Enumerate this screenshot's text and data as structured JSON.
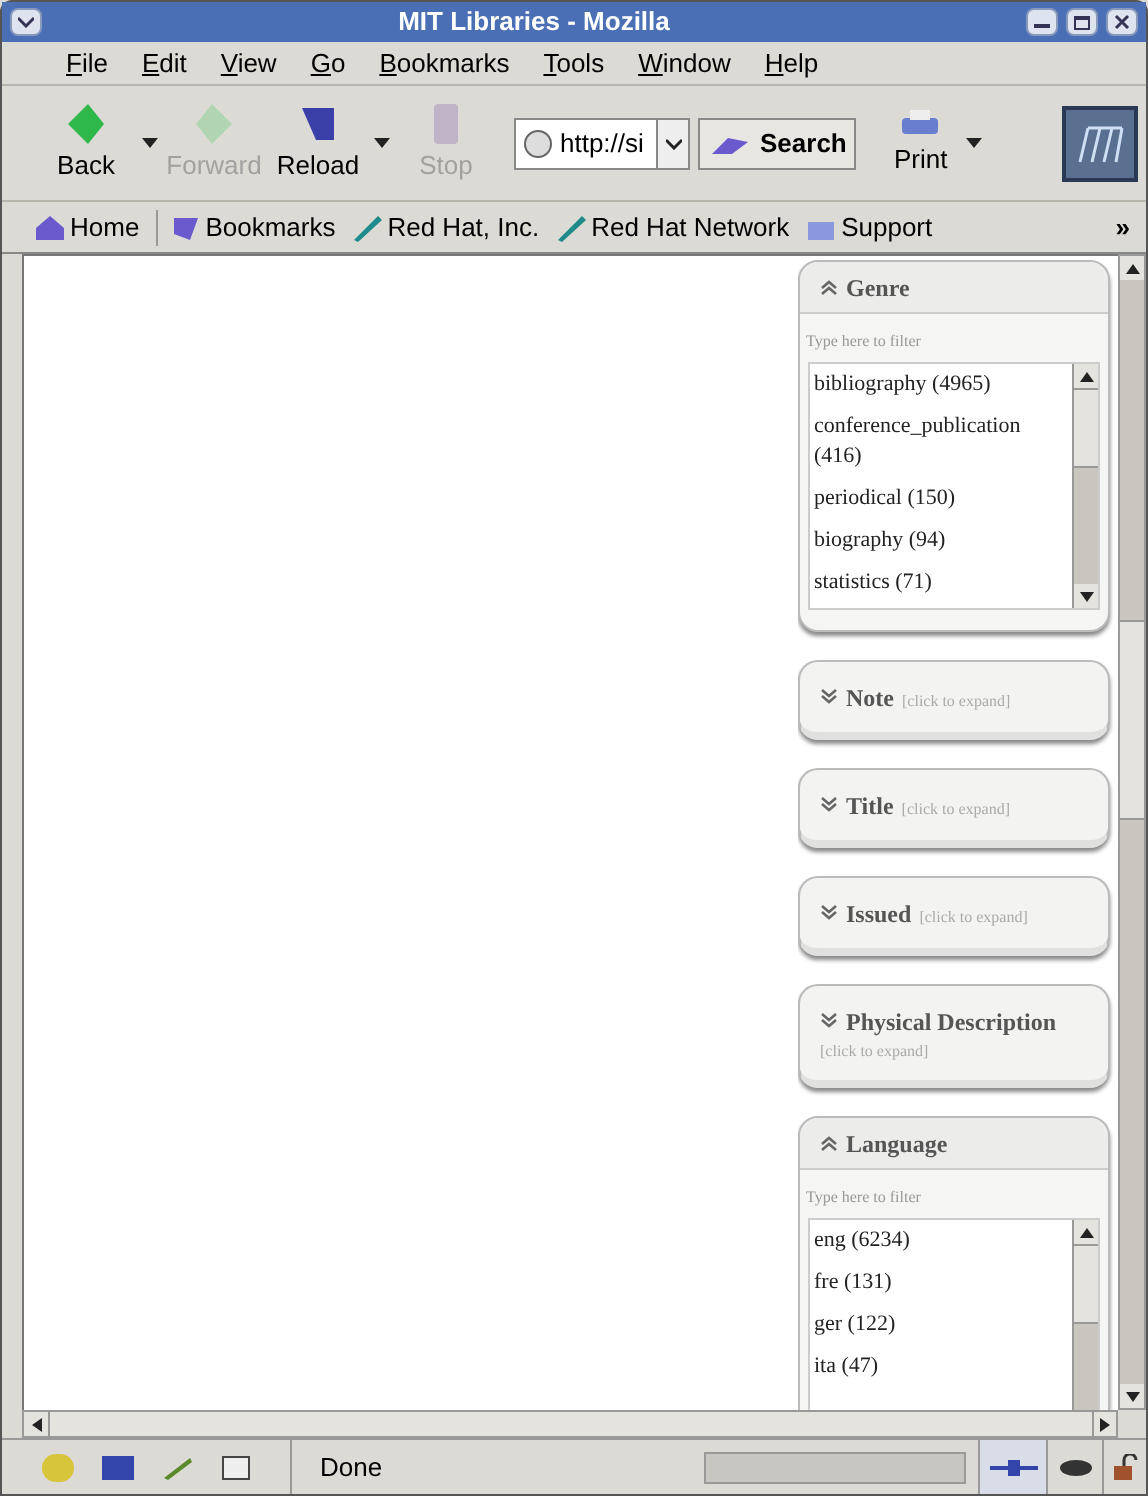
{
  "window": {
    "title": "MIT Libraries - Mozilla"
  },
  "menu": [
    "File",
    "Edit",
    "View",
    "Go",
    "Bookmarks",
    "Tools",
    "Window",
    "Help"
  ],
  "toolbar": [
    {
      "label": "Back",
      "disabled": false,
      "kind": "back"
    },
    {
      "label": "Forward",
      "disabled": true,
      "kind": "forward"
    },
    {
      "label": "Reload",
      "disabled": false,
      "kind": "reload"
    },
    {
      "label": "Stop",
      "disabled": true,
      "kind": "stop"
    }
  ],
  "url": {
    "value": "http://si"
  },
  "search_button": "Search",
  "print_button": "Print",
  "bookmarks": [
    {
      "label": "Home",
      "kind": "home"
    },
    {
      "label": "Bookmarks",
      "kind": "bookmarks"
    },
    {
      "label": "Red Hat, Inc.",
      "kind": "link"
    },
    {
      "label": "Red Hat Network",
      "kind": "link"
    },
    {
      "label": "Support",
      "kind": "support"
    }
  ],
  "bookmarks_more": "»",
  "facets": [
    {
      "title": "Genre",
      "expanded": true,
      "filter_placeholder": "Type here to filter",
      "items": [
        "bibliography (4965)",
        "conference_publication (416)",
        "periodical (150)",
        "biography (94)",
        "statistics (71)"
      ]
    },
    {
      "title": "Note",
      "expanded": false,
      "hint": "[click to expand]"
    },
    {
      "title": "Title",
      "expanded": false,
      "hint": "[click to expand]"
    },
    {
      "title": "Issued",
      "expanded": false,
      "hint": "[click to expand]"
    },
    {
      "title": "Physical Description",
      "expanded": false,
      "hint": "[click to expand]"
    },
    {
      "title": "Language",
      "expanded": true,
      "filter_placeholder": "Type here to filter",
      "items": [
        "eng (6234)",
        "fre (131)",
        "ger (122)",
        "ita (47)"
      ]
    }
  ],
  "status_bar": {
    "text": "Done",
    "progress": {
      "level": 0
    }
  }
}
